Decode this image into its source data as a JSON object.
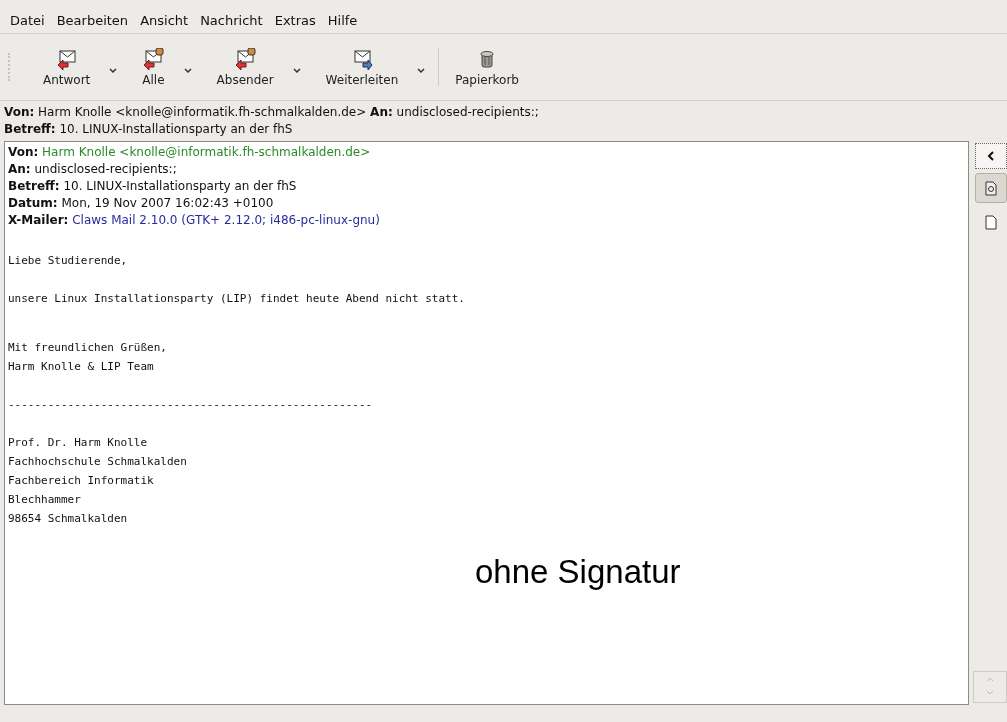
{
  "menu": [
    "Datei",
    "Bearbeiten",
    "Ansicht",
    "Nachricht",
    "Extras",
    "Hilfe"
  ],
  "toolbar": [
    {
      "label": "Antwort",
      "kind": "reply",
      "dropdown": true
    },
    {
      "label": "Alle",
      "kind": "reply-all",
      "dropdown": true
    },
    {
      "label": "Absender",
      "kind": "reply-sender",
      "dropdown": true
    },
    {
      "label": "Weiterleiten",
      "kind": "forward",
      "dropdown": true
    },
    {
      "label": "Papierkorb",
      "kind": "trash",
      "dropdown": false
    }
  ],
  "summary": [
    "**Von:** Harm Knolle <knolle@informatik.fh-schmalkalden.de> **An:** undisclosed-recipients:;",
    "**Betreff:** 10. LINUX-Installationsparty an der fhS"
  ],
  "headers": [
    {
      "label": "Von:",
      "value": "Harm Knolle <knolle@informatik.fh-schmalkalden.de>",
      "kind": "sender"
    },
    {
      "label": "An:",
      "value": "undisclosed-recipients:;",
      "kind": "plain"
    },
    {
      "label": "Betreff:",
      "value": "10. LINUX-Installationsparty an der fhS",
      "kind": "plain"
    },
    {
      "label": "Datum:",
      "value": "Mon, 19 Nov 2007 16:02:43 +0100",
      "kind": "plain"
    },
    {
      "label": "X-Mailer:",
      "value": "Claws Mail 2.10.0 (GTK+ 2.12.0; i486-pc-linux-gnu)",
      "kind": "mailer"
    }
  ],
  "body": [
    {
      "kind": "near",
      "lines": [
        "Liebe Studierende,"
      ]
    },
    {
      "kind": "near",
      "lines": [
        "unsere Linux Installationsparty (LIP) findet heute Abend nicht statt."
      ]
    },
    {
      "kind": "far",
      "lines": [
        "Mit freundlichen Grüßen,",
        "Harm Knolle & LIP Team"
      ]
    },
    {
      "kind": "mid",
      "lines": [
        "-------------------------------------------------------"
      ]
    },
    {
      "kind": "near",
      "lines": [
        "Prof. Dr. Harm Knolle",
        "Fachhochschule Schmalkalden",
        "Fachbereich Informatik",
        "Blechhammer",
        "98654 Schmalkalden"
      ]
    }
  ],
  "annotation": "ohne Signatur",
  "side_tabs": [
    {
      "kind": "collapse",
      "selected": false
    },
    {
      "kind": "mail",
      "selected": true
    },
    {
      "kind": "text",
      "selected": false
    }
  ]
}
